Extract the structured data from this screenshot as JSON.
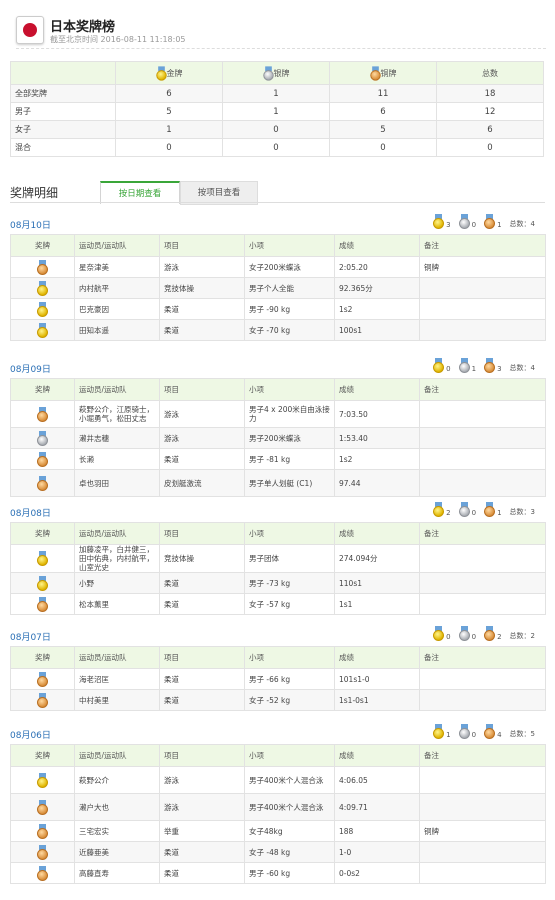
{
  "header": {
    "title": "日本奖牌榜",
    "updated": "截至北京时间 2016-08-11 11:18:05"
  },
  "colors": {
    "accent": "#3aa639",
    "link": "#2a6fb5",
    "header_bg": "#eef8e4"
  },
  "summary": {
    "headers": [
      "",
      "金牌",
      "银牌",
      "铜牌",
      "总数"
    ],
    "rows": [
      {
        "label": "全部奖牌",
        "gold": "6",
        "silver": "1",
        "bronze": "11",
        "total": "18"
      },
      {
        "label": "男子",
        "gold": "5",
        "silver": "1",
        "bronze": "6",
        "total": "12"
      },
      {
        "label": "女子",
        "gold": "1",
        "silver": "0",
        "bronze": "5",
        "total": "6"
      },
      {
        "label": "混合",
        "gold": "0",
        "silver": "0",
        "bronze": "0",
        "total": "0"
      }
    ]
  },
  "detail": {
    "title": "奖牌明细",
    "tabs": [
      "按日期查看",
      "按项目查看"
    ]
  },
  "columns": [
    "奖牌",
    "运动员/运动队",
    "项目",
    "小项",
    "成绩",
    "备注"
  ],
  "days": [
    {
      "date": "08月10日",
      "gold": "3",
      "silver": "0",
      "bronze": "1",
      "total": "总数：4",
      "rows": [
        {
          "medal": "bronze",
          "athlete": "星奈津美",
          "sport": "游泳",
          "event": "女子200米蝶泳",
          "result": "2:05.20",
          "note": "铜牌"
        },
        {
          "medal": "gold",
          "athlete": "内村航平",
          "sport": "竞技体操",
          "event": "男子个人全能",
          "result": "92.365分",
          "note": ""
        },
        {
          "medal": "gold",
          "athlete": "巴克豪因",
          "sport": "柔道",
          "event": "男子 -90 kg",
          "result": "1s2",
          "note": ""
        },
        {
          "medal": "gold",
          "athlete": "田知本遥",
          "sport": "柔道",
          "event": "女子 -70 kg",
          "result": "100s1",
          "note": ""
        }
      ]
    },
    {
      "date": "08月09日",
      "gold": "0",
      "silver": "1",
      "bronze": "3",
      "total": "总数：4",
      "rows": [
        {
          "medal": "bronze",
          "athlete": "萩野公介，江原骑士，小堀勇气，松田丈志",
          "sport": "游泳",
          "event": "男子4 x 200米自由泳接力",
          "result": "7:03.50",
          "note": ""
        },
        {
          "medal": "silver",
          "athlete": "濑井志穗",
          "sport": "游泳",
          "event": "男子200米蝶泳",
          "result": "1:53.40",
          "note": ""
        },
        {
          "medal": "bronze",
          "athlete": "长濑",
          "sport": "柔道",
          "event": "男子 -81 kg",
          "result": "1s2",
          "note": ""
        },
        {
          "medal": "bronze",
          "athlete": "卓也羽田",
          "sport": "皮划艇激流",
          "event": "男子单人划艇 (C1)",
          "result": "97.44",
          "note": ""
        }
      ]
    },
    {
      "date": "08月08日",
      "gold": "2",
      "silver": "0",
      "bronze": "1",
      "total": "总数：3",
      "rows": [
        {
          "medal": "gold",
          "athlete": "加藤凌平，白井健三，田中佑典，内村航平，山室光史",
          "sport": "竞技体操",
          "event": "男子团体",
          "result": "274.094分",
          "note": ""
        },
        {
          "medal": "gold",
          "athlete": "小野",
          "sport": "柔道",
          "event": "男子 -73 kg",
          "result": "110s1",
          "note": ""
        },
        {
          "medal": "bronze",
          "athlete": "松本薰里",
          "sport": "柔道",
          "event": "女子 -57 kg",
          "result": "1s1",
          "note": ""
        }
      ]
    },
    {
      "date": "08月07日",
      "gold": "0",
      "silver": "0",
      "bronze": "2",
      "total": "总数：2",
      "rows": [
        {
          "medal": "bronze",
          "athlete": "海老沼匡",
          "sport": "柔道",
          "event": "男子 -66 kg",
          "result": "101s1-0",
          "note": ""
        },
        {
          "medal": "bronze",
          "athlete": "中村美里",
          "sport": "柔道",
          "event": "女子 -52 kg",
          "result": "1s1-0s1",
          "note": ""
        }
      ]
    },
    {
      "date": "08月06日",
      "gold": "1",
      "silver": "0",
      "bronze": "4",
      "total": "总数：5",
      "rows": [
        {
          "medal": "gold",
          "athlete": "萩野公介",
          "sport": "游泳",
          "event": "男子400米个人混合泳",
          "result": "4:06.05",
          "note": ""
        },
        {
          "medal": "bronze",
          "athlete": "濑户大也",
          "sport": "游泳",
          "event": "男子400米个人混合泳",
          "result": "4:09.71",
          "note": ""
        },
        {
          "medal": "bronze",
          "athlete": "三宅宏实",
          "sport": "举重",
          "event": "女子48kg",
          "result": "188",
          "note": "铜牌"
        },
        {
          "medal": "bronze",
          "athlete": "近藤亜美",
          "sport": "柔道",
          "event": "女子 -48 kg",
          "result": "1-0",
          "note": ""
        },
        {
          "medal": "bronze",
          "athlete": "高藤直寿",
          "sport": "柔道",
          "event": "男子 -60 kg",
          "result": "0-0s2",
          "note": ""
        }
      ]
    }
  ]
}
